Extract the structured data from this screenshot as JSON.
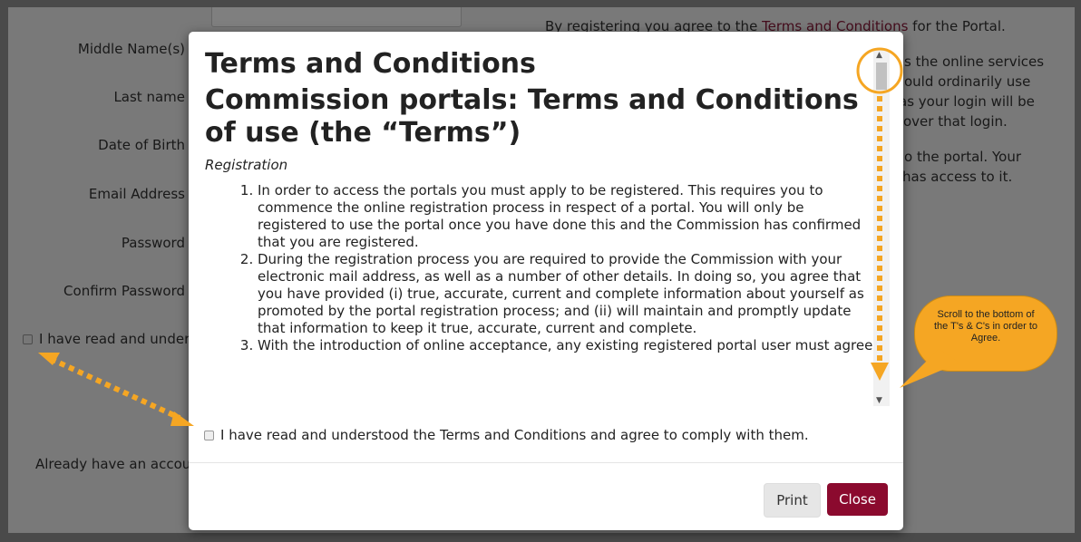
{
  "background_form": {
    "labels": {
      "middle_name": "Middle Name(s)",
      "last_name": "Last name",
      "dob": "Date of Birth",
      "email": "Email Address",
      "password": "Password",
      "confirm_password": "Confirm Password",
      "agree_partial": "I have read and under",
      "already": "Already have an accou"
    },
    "right_text": {
      "line1_pre": "By registering you agree to the ",
      "line1_link": "Terms and Conditions",
      "line1_post": " for the Portal.",
      "p2_l1": "s the online services",
      "p2_l2": "ould ordinarily use",
      "p2_l3": "as your login will be",
      "p2_l4": "over that login.",
      "p3_l1": "o the portal. Your",
      "p3_l2": "has access to it."
    }
  },
  "modal": {
    "title": "Terms and Conditions",
    "subtitle_line1": "Commission portals: Terms and Conditions",
    "subtitle_line2": "of use (the “Terms”)",
    "section": "Registration",
    "items": [
      "In order to access the portals you must apply to be registered. This requires you to commence the online registration process in respect of a portal. You will only be registered to use the portal once you have done this and the Commission has confirmed that you are registered.",
      "During the registration process you are required to provide the Commission with your electronic mail address, as well as a number of other details. In doing so, you agree that you have provided (i) true, accurate, current and complete information about yourself as promoted by the portal registration process; and (ii) will maintain and promptly update that information to keep it true, accurate, current and complete.",
      "With the introduction of online acceptance, any existing registered portal user must agree"
    ],
    "agree_label": "I have read and understood the Terms and Conditions and agree to comply with them.",
    "print_label": "Print",
    "close_label": "Close"
  },
  "annotation": {
    "callout_text": "Scroll to the bottom of the T's & C's in order to Agree.",
    "color": "#f5a623"
  }
}
